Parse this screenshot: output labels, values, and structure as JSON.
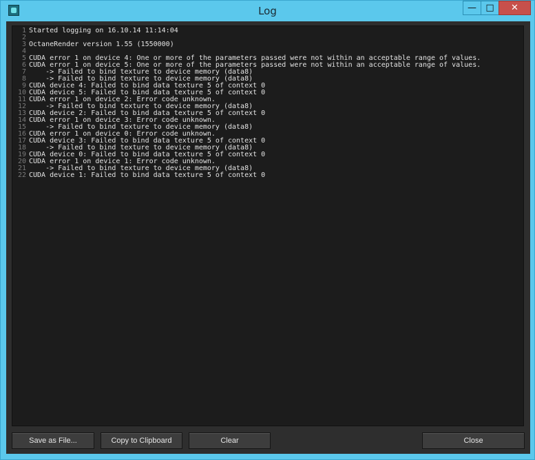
{
  "window": {
    "title": "Log",
    "controls": {
      "minimize": "—",
      "maximize": "□",
      "close": "✕"
    }
  },
  "log": {
    "lines": [
      {
        "n": "1",
        "t": "Started logging on 16.10.14 11:14:04"
      },
      {
        "n": "2",
        "t": ""
      },
      {
        "n": "3",
        "t": "OctaneRender version 1.55 (1550000)"
      },
      {
        "n": "4",
        "t": ""
      },
      {
        "n": "5",
        "t": "CUDA error 1 on device 4: One or more of the parameters passed were not within an acceptable range of values."
      },
      {
        "n": "6",
        "t": "CUDA error 1 on device 5: One or more of the parameters passed were not within an acceptable range of values."
      },
      {
        "n": "7",
        "t": "    -> Failed to bind texture to device memory (data8)"
      },
      {
        "n": "8",
        "t": "    -> Failed to bind texture to device memory (data8)"
      },
      {
        "n": "9",
        "t": "CUDA device 4: Failed to bind data texture 5 of context 0"
      },
      {
        "n": "10",
        "t": "CUDA device 5: Failed to bind data texture 5 of context 0"
      },
      {
        "n": "11",
        "t": "CUDA error 1 on device 2: Error code unknown."
      },
      {
        "n": "12",
        "t": "    -> Failed to bind texture to device memory (data8)"
      },
      {
        "n": "13",
        "t": "CUDA device 2: Failed to bind data texture 5 of context 0"
      },
      {
        "n": "14",
        "t": "CUDA error 1 on device 3: Error code unknown."
      },
      {
        "n": "15",
        "t": "    -> Failed to bind texture to device memory (data8)"
      },
      {
        "n": "16",
        "t": "CUDA error 1 on device 0: Error code unknown."
      },
      {
        "n": "17",
        "t": "CUDA device 3: Failed to bind data texture 5 of context 0"
      },
      {
        "n": "18",
        "t": "    -> Failed to bind texture to device memory (data8)"
      },
      {
        "n": "19",
        "t": "CUDA device 0: Failed to bind data texture 5 of context 0"
      },
      {
        "n": "20",
        "t": "CUDA error 1 on device 1: Error code unknown."
      },
      {
        "n": "21",
        "t": "    -> Failed to bind texture to device memory (data8)"
      },
      {
        "n": "22",
        "t": "CUDA device 1: Failed to bind data texture 5 of context 0"
      }
    ]
  },
  "buttons": {
    "save": "Save as File...",
    "copy": "Copy to Clipboard",
    "clear": "Clear",
    "close": "Close"
  }
}
